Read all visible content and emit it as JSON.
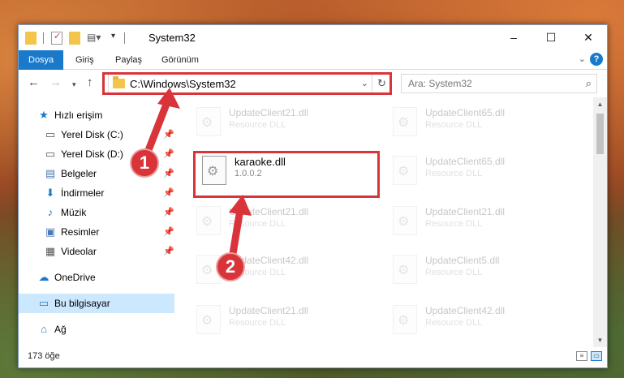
{
  "window": {
    "title": "System32",
    "controls": {
      "minimize_icon": "–",
      "maximize_icon": "☐",
      "close_icon": "✕"
    }
  },
  "ribbon": {
    "tabs": [
      "Dosya",
      "Giriş",
      "Paylaş",
      "Görünüm"
    ],
    "help_icon": "?"
  },
  "address_bar": {
    "path": "C:\\Windows\\System32",
    "search_placeholder": "Ara: System32"
  },
  "sidebar": {
    "items": [
      {
        "label": "Hızlı erişim",
        "icon": "★"
      },
      {
        "label": "Yerel Disk (C:)",
        "icon": "▭"
      },
      {
        "label": "Yerel Disk (D:)",
        "icon": "▭"
      },
      {
        "label": "Belgeler",
        "icon": "▤"
      },
      {
        "label": "İndirmeler",
        "icon": "⬇"
      },
      {
        "label": "Müzik",
        "icon": "♪"
      },
      {
        "label": "Resimler",
        "icon": "▣"
      },
      {
        "label": "Videolar",
        "icon": "▦"
      },
      {
        "label": "OneDrive",
        "icon": "☁"
      },
      {
        "label": "Bu bilgisayar",
        "icon": "▭"
      },
      {
        "label": "Ağ",
        "icon": "⌂"
      }
    ]
  },
  "files": [
    {
      "name": "UpdateClient21.dll",
      "desc": "Resource DLL"
    },
    {
      "name": "UpdateClient65.dll",
      "desc": "Resource DLL"
    },
    {
      "name": "karaoke.dll",
      "desc": "1.0.0.2"
    },
    {
      "name": "UpdateClient65.dll",
      "desc": "Resource DLL"
    },
    {
      "name": "UpdateClient21.dll",
      "desc": "Resource DLL"
    },
    {
      "name": "UpdateClient21.dll",
      "desc": "Resource DLL"
    },
    {
      "name": "UpdateClient42.dll",
      "desc": "Resource DLL"
    },
    {
      "name": "UpdateClient5.dll",
      "desc": "Resource DLL"
    },
    {
      "name": "UpdateClient21.dll",
      "desc": "Resource DLL"
    },
    {
      "name": "UpdateClient42.dll",
      "desc": "Resource DLL"
    }
  ],
  "status": {
    "count": "173 öğe"
  },
  "annotations": {
    "step1": "1",
    "step2": "2"
  },
  "colors": {
    "accent": "#1979ca",
    "annotation": "#d9343a"
  }
}
